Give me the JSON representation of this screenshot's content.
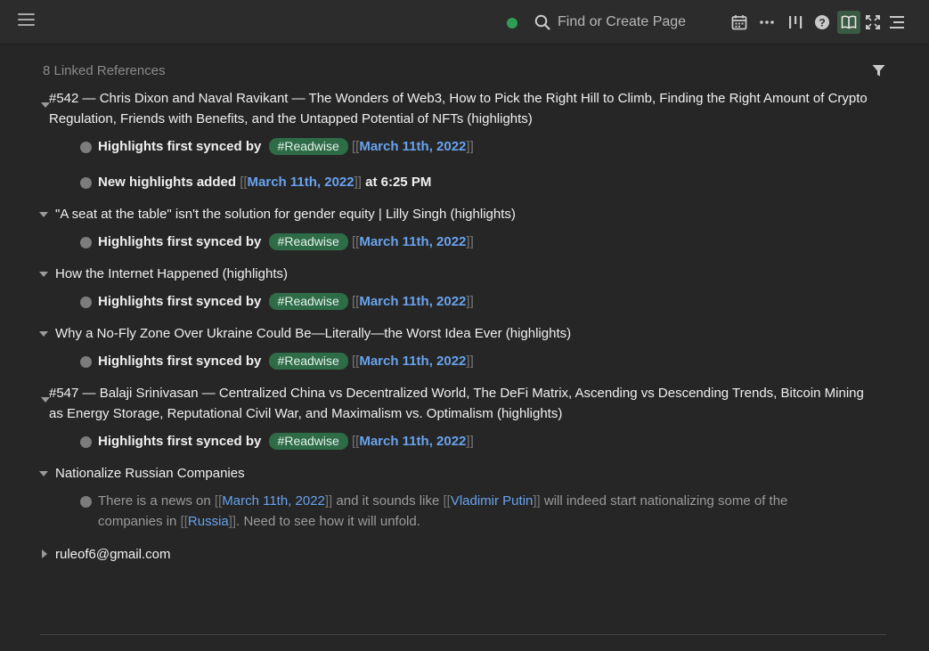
{
  "topbar": {
    "search_placeholder": "Find or Create Page",
    "sync_status_color": "#2f9e55",
    "icons": [
      "menu-icon",
      "search-icon",
      "calendar-icon",
      "more-icon",
      "columns-icon",
      "help-icon",
      "book-icon",
      "expand-icon",
      "align-icon"
    ]
  },
  "linked_refs": {
    "header": "8 Linked References",
    "items": [
      {
        "title": "#542 — Chris Dixon and Naval Ravikant — The Wonders of Web3, How to Pick the Right Hill to Climb, Finding the Right Amount of Crypto Regulation, Friends with Benefits, and the Untapped Potential of NFTs (highlights)"
      },
      {
        "title": "\"A seat at the table\" isn't the solution for gender equity | Lilly Singh (highlights)"
      },
      {
        "title": "How the Internet Happened (highlights)"
      },
      {
        "title": "Why a No-Fly Zone Over Ukraine Could Be—Literally—the Worst Idea Ever (highlights)"
      },
      {
        "title": "#547 — Balaji Srinivasan — Centralized China vs Decentralized World, The DeFi Matrix, Ascending vs Descending Trends, Bitcoin Mining as Energy Storage, Reputational Civil War, and Maximalism vs. Optimalism (highlights)"
      },
      {
        "title": "Nationalize Russian Companies"
      },
      {
        "title": "ruleof6@gmail.com"
      }
    ]
  },
  "blocks": {
    "synced_prefix": "Highlights first synced by",
    "readwise_tag": "#Readwise",
    "date_link": "March 11th, 2022",
    "bracket_open": "[[",
    "bracket_close": "]]",
    "new_highlights_prefix": "New highlights added",
    "new_highlights_time": "at 6:25 PM",
    "news_part1": "There is a news on",
    "news_part2": "and it sounds like",
    "news_link_putin": "Vladimir Putin",
    "news_part3": "will indeed start nationalizing some of the companies in",
    "news_link_russia": "Russia",
    "news_part4": ". Need to see how it will unfold."
  }
}
